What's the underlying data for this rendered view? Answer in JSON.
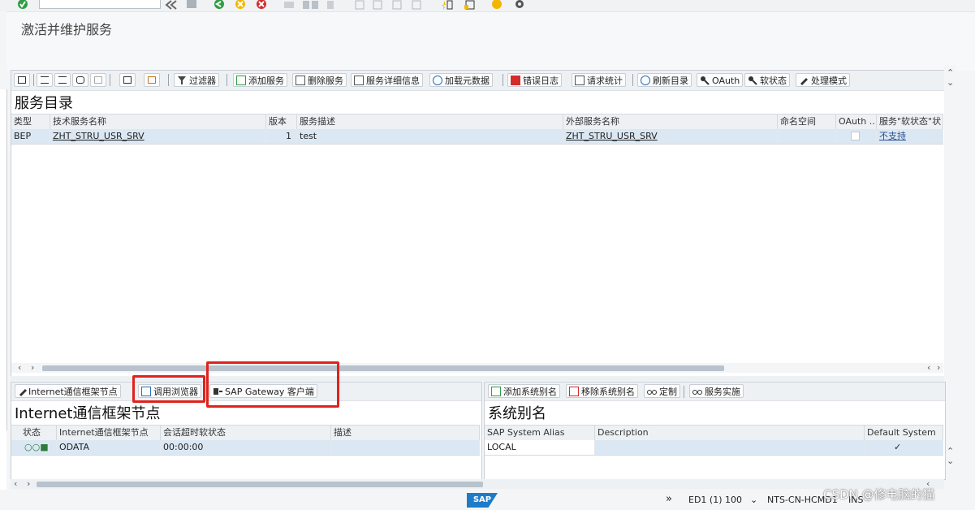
{
  "page": {
    "title": "激活并维护服务"
  },
  "toolbar": {
    "filter": "过滤器",
    "add_service": "添加服务",
    "delete_service": "删除服务",
    "service_details": "服务详细信息",
    "load_metadata": "加载元数据",
    "error_log": "错误日志",
    "request_stats": "请求统计",
    "refresh_catalog": "刷新目录",
    "oauth": "OAuth",
    "soft_state": "软状态",
    "processing_mode": "处理模式"
  },
  "catalog": {
    "title": "服务目录",
    "columns": [
      "类型",
      "技术服务名称",
      "版本",
      "服务描述",
      "外部服务名称",
      "命名空间",
      "OAuth ...",
      "服务\"软状态\"状"
    ],
    "rows": [
      {
        "type": "BEP",
        "tech_name": "ZHT_STRU_USR_SRV",
        "version": "1",
        "description": "test",
        "external_name": "ZHT_STRU_USR_SRV",
        "namespace": "",
        "oauth": "",
        "soft_state": "不支持"
      }
    ]
  },
  "icf": {
    "toolbar": {
      "icf_node": "Internet通信框架节点",
      "call_browser": "调用浏览器",
      "gateway_client": "SAP Gateway 客户端"
    },
    "title": "Internet通信框架节点",
    "columns": [
      "状态",
      "Internet通信框架节点",
      "会话超时软状态",
      "描述"
    ],
    "rows": [
      {
        "status": "○○■",
        "node": "ODATA",
        "timeout": "00:00:00",
        "description": ""
      }
    ]
  },
  "alias": {
    "toolbar": {
      "add_alias": "添加系统别名",
      "remove_alias": "移除系统别名",
      "customize": "定制",
      "service_impl": "服务实施"
    },
    "title": "系统别名",
    "columns": [
      "SAP System Alias",
      "Description",
      "Default System"
    ],
    "rows": [
      {
        "alias": "LOCAL",
        "description": "",
        "default": "✓"
      }
    ]
  },
  "status_bar": {
    "system": "ED1 (1) 100",
    "host": "NTS-CN-HCMD1",
    "mode": "INS",
    "logo": "SAP"
  },
  "watermark": "CSDN @修电脑的猫",
  "colors": {
    "highlight": "#e0221c",
    "selected_row": "#dbe8f4"
  }
}
